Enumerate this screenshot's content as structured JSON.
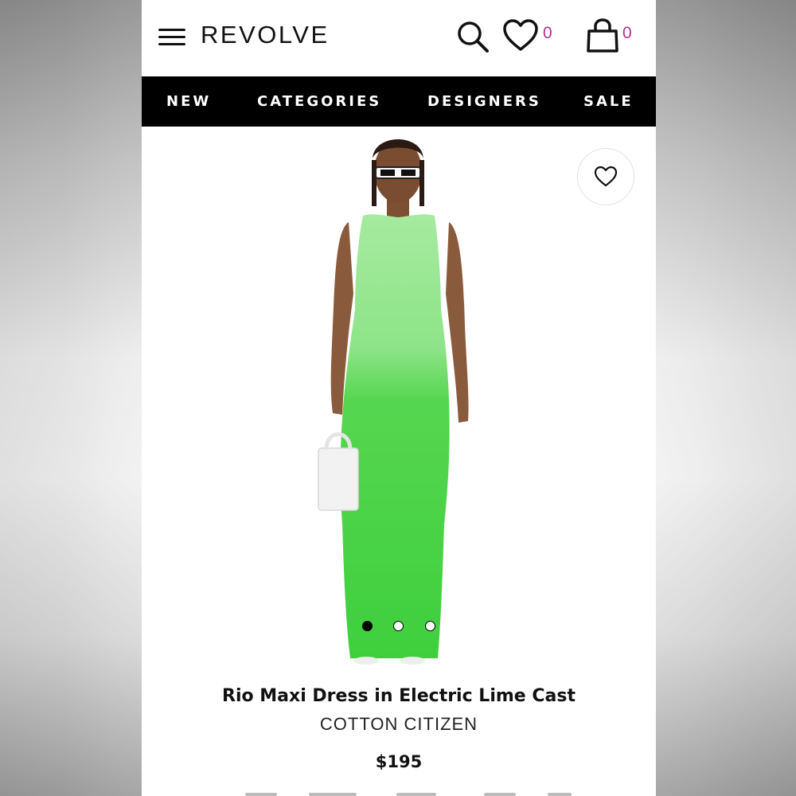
{
  "header": {
    "logo": "REVOLVE",
    "wishlist_count": "0",
    "cart_count": "0"
  },
  "nav": {
    "items": [
      "NEW",
      "CATEGORIES",
      "DESIGNERS",
      "SALE"
    ]
  },
  "product": {
    "title": "Rio Maxi Dress in Electric Lime Cast",
    "brand": "COTTON CITIZEN",
    "price": "$195",
    "carousel_slides": 3,
    "active_slide": 1
  },
  "colors": {
    "accent_count": "#b0338f",
    "nav_bg": "#000000",
    "dress_green": "#4fd44b"
  },
  "icons": [
    "menu-icon",
    "search-icon",
    "heart-icon",
    "shopping-bag-icon"
  ]
}
